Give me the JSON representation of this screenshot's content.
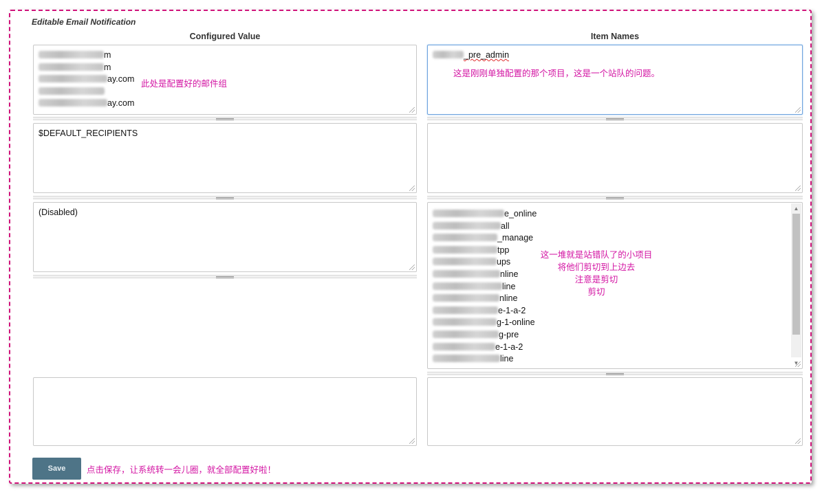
{
  "form_title": "Editable Email Notification",
  "headers": {
    "configured": "Configured Value",
    "items": "Item Names"
  },
  "row1": {
    "configured_lines": [
      "m",
      "m",
      "ay.com",
      "",
      "ay.com"
    ],
    "configured_annotation": "此处是配置好的邮件组",
    "item_text": "_pre_admin",
    "item_annotation": "这是刚刚单独配置的那个项目，这是一个站队的问题。"
  },
  "row2": {
    "configured_value": "$DEFAULT_RECIPIENTS",
    "item_text": ""
  },
  "row3": {
    "configured_value": "(Disabled)",
    "item_lines": [
      "e_online",
      "all",
      "_manage",
      "tpp",
      "ups",
      "nline",
      "line",
      "nline",
      "e-1-a-2",
      "g-1-online",
      "g-pre",
      "e-1-a-2",
      "line"
    ],
    "annotation_lines": [
      "这一堆就是站错队了的小项目",
      "将他们剪切到上边去",
      "注意是剪切",
      "剪切"
    ]
  },
  "row4": {
    "configured_value": "",
    "item_text": ""
  },
  "save": {
    "label": "Save",
    "annotation": "点击保存，让系统转一会儿圈，就全部配置好啦！"
  },
  "colors": {
    "annotation": "#d315a3",
    "frame_border": "#d0127a",
    "save_button": "#4e7487",
    "focus_border": "#6ea3dd"
  }
}
